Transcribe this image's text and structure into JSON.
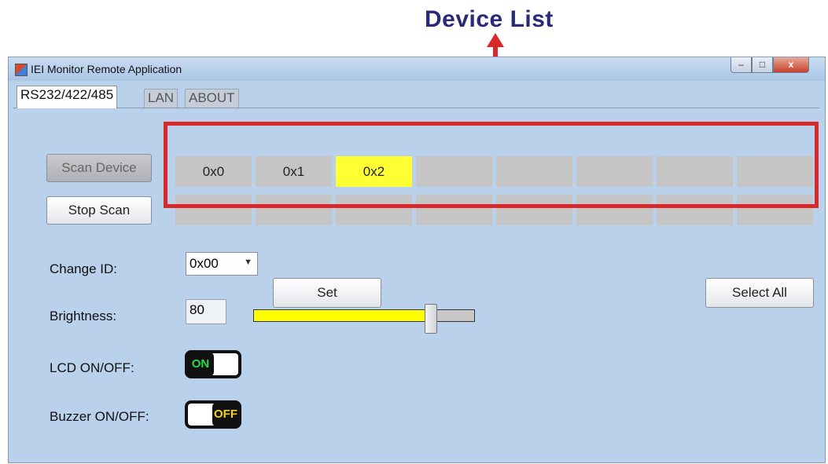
{
  "annotation": {
    "title": "Device List"
  },
  "window": {
    "title": "IEI Monitor Remote Application",
    "controls": {
      "minimize": "–",
      "maximize": "□",
      "close": "x"
    }
  },
  "tabs": [
    {
      "label": "RS232/422/485",
      "active": true
    },
    {
      "label": "LAN",
      "active": false
    },
    {
      "label": "ABOUT",
      "active": false
    }
  ],
  "buttons": {
    "scan_device": "Scan Device",
    "stop_scan": "Stop Scan",
    "set": "Set",
    "select_all": "Select All"
  },
  "device_grid": {
    "row1": [
      "0x0",
      "0x1",
      "0x2",
      "",
      "",
      "",
      "",
      ""
    ],
    "row2": [
      "",
      "",
      "",
      "",
      "",
      "",
      "",
      ""
    ],
    "selected": "0x2"
  },
  "form": {
    "change_id_label": "Change ID:",
    "change_id_value": "0x00",
    "brightness_label": "Brightness:",
    "brightness_value": "80",
    "lcd_label": "LCD ON/OFF:",
    "lcd_state": "ON",
    "buzzer_label": "Buzzer ON/OFF:",
    "buzzer_state": "OFF"
  },
  "colors": {
    "window_bg": "#b9d1ea",
    "selected_cell": "#ffff33",
    "annotation_red": "#d8282a",
    "annotation_text": "#2a2a7a",
    "on_green": "#29d94a",
    "off_yellow": "#f2d21a"
  }
}
